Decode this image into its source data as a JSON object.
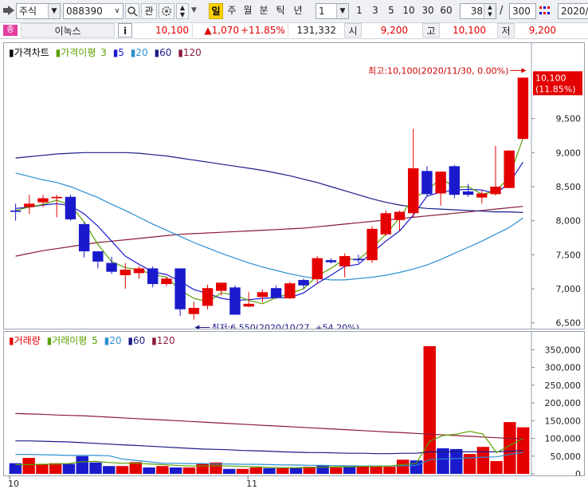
{
  "toolbar": {
    "market": "주식",
    "code": "088390",
    "btn_gwan": "관",
    "periods": [
      "일",
      "주",
      "월",
      "분",
      "틱",
      "년"
    ],
    "period_selected": "일",
    "interval_value": "1",
    "quick_intervals": [
      "1",
      "3",
      "5",
      "10",
      "30",
      "60"
    ],
    "count_value": "38",
    "separator": "/",
    "total_value": "300",
    "date_value": "2020/"
  },
  "quote": {
    "icon_label": "종",
    "name": "이녹스",
    "info_label": "i",
    "price": "10,100",
    "change": "▲1,070",
    "change_rate": "+11.85%",
    "volume": "131,332",
    "open_label": "시",
    "open": "9,200",
    "high_label": "고",
    "high": "10,100",
    "low_label": "저",
    "low": "9,200"
  },
  "price_legend": {
    "title": "가격차트",
    "ma_title": "가격이평",
    "ma_periods": [
      "3",
      "5",
      "20",
      "60",
      "120"
    ]
  },
  "volume_legend": {
    "title": "거래량",
    "ma_title": "거래이평",
    "ma_periods": [
      "5",
      "20",
      "60",
      "120"
    ]
  },
  "colors": {
    "up": "#e40000",
    "down": "#1a1acc",
    "ma3": "#5aa000",
    "ma5": "#1a1acc",
    "ma20": "#2a8fd0",
    "ma60": "#1c1c88",
    "ma120": "#8b1a3a",
    "annotation": "#cc0000"
  },
  "annotations": {
    "high_text": "최고:10,100(2020/11/30, 0.00%)",
    "low_text": "최저:6,550(2020/10/27, +54.20%)",
    "last_price": "10,100",
    "last_rate": "(11.85%)"
  },
  "chart_data": {
    "type": "candlestick",
    "x_labels": [
      "10",
      "11"
    ],
    "price_axis": {
      "ticks": [
        "9,500",
        "9,000",
        "8,500",
        "8,000",
        "7,500",
        "7,000",
        "6,500"
      ],
      "min": 6450,
      "max": 10350
    },
    "volume_axis": {
      "ticks": [
        "350,000",
        "300,000",
        "250,000",
        "200,000",
        "150,000",
        "100,000",
        "50,000",
        "0"
      ],
      "min": 0,
      "max": 360000
    },
    "candles": [
      {
        "o": 8150,
        "h": 8250,
        "l": 8000,
        "c": 8130
      },
      {
        "o": 8200,
        "h": 8380,
        "l": 8100,
        "c": 8250
      },
      {
        "o": 8270,
        "h": 8380,
        "l": 8200,
        "c": 8330
      },
      {
        "o": 8330,
        "h": 8380,
        "l": 8050,
        "c": 8350
      },
      {
        "o": 8350,
        "h": 8380,
        "l": 8000,
        "c": 8020
      },
      {
        "o": 7950,
        "h": 7980,
        "l": 7460,
        "c": 7550
      },
      {
        "o": 7550,
        "h": 7550,
        "l": 7300,
        "c": 7400
      },
      {
        "o": 7380,
        "h": 7470,
        "l": 7220,
        "c": 7250
      },
      {
        "o": 7200,
        "h": 7380,
        "l": 7000,
        "c": 7280
      },
      {
        "o": 7230,
        "h": 7330,
        "l": 7150,
        "c": 7300
      },
      {
        "o": 7300,
        "h": 7330,
        "l": 7020,
        "c": 7070
      },
      {
        "o": 7070,
        "h": 7180,
        "l": 7040,
        "c": 7150
      },
      {
        "o": 7300,
        "h": 7300,
        "l": 6600,
        "c": 6700
      },
      {
        "o": 6630,
        "h": 6810,
        "l": 6550,
        "c": 6720
      },
      {
        "o": 6750,
        "h": 7060,
        "l": 6700,
        "c": 7010
      },
      {
        "o": 6970,
        "h": 7080,
        "l": 6900,
        "c": 7090
      },
      {
        "o": 7020,
        "h": 7050,
        "l": 6620,
        "c": 6620
      },
      {
        "o": 6740,
        "h": 6950,
        "l": 6730,
        "c": 6780
      },
      {
        "o": 6880,
        "h": 6990,
        "l": 6800,
        "c": 6950
      },
      {
        "o": 7010,
        "h": 7050,
        "l": 6850,
        "c": 6870
      },
      {
        "o": 6860,
        "h": 7100,
        "l": 6850,
        "c": 7080
      },
      {
        "o": 7130,
        "h": 7150,
        "l": 7000,
        "c": 7050
      },
      {
        "o": 7140,
        "h": 7480,
        "l": 7080,
        "c": 7450
      },
      {
        "o": 7420,
        "h": 7450,
        "l": 7370,
        "c": 7390
      },
      {
        "o": 7330,
        "h": 7520,
        "l": 7170,
        "c": 7480
      },
      {
        "o": 7440,
        "h": 7500,
        "l": 7380,
        "c": 7420
      },
      {
        "o": 7420,
        "h": 7920,
        "l": 7380,
        "c": 7880
      },
      {
        "o": 7800,
        "h": 8150,
        "l": 7780,
        "c": 8110
      },
      {
        "o": 8010,
        "h": 8150,
        "l": 7850,
        "c": 8130
      },
      {
        "o": 8110,
        "h": 9350,
        "l": 8050,
        "c": 8770
      },
      {
        "o": 8730,
        "h": 8800,
        "l": 8350,
        "c": 8390
      },
      {
        "o": 8400,
        "h": 8720,
        "l": 8220,
        "c": 8720
      },
      {
        "o": 8800,
        "h": 8820,
        "l": 8330,
        "c": 8380
      },
      {
        "o": 8430,
        "h": 8540,
        "l": 8350,
        "c": 8380
      },
      {
        "o": 8340,
        "h": 8440,
        "l": 8250,
        "c": 8400
      },
      {
        "o": 8390,
        "h": 9100,
        "l": 8370,
        "c": 8500
      },
      {
        "o": 8480,
        "h": 9030,
        "l": 8480,
        "c": 9030
      },
      {
        "o": 9200,
        "h": 10100,
        "l": 9200,
        "c": 10100
      }
    ],
    "volumes": [
      30000,
      45000,
      28000,
      30000,
      28000,
      50000,
      32000,
      22000,
      22000,
      33000,
      18000,
      22000,
      18000,
      18000,
      28000,
      32000,
      14000,
      14000,
      18000,
      16000,
      16000,
      18000,
      20000,
      24000,
      18000,
      20000,
      22000,
      20000,
      20000,
      40000,
      38000,
      360000,
      72000,
      70000,
      56000,
      76000,
      36000,
      146000,
      131332
    ],
    "ma_price": {
      "ma3": [
        8150,
        8200,
        8240,
        8300,
        8230,
        7980,
        7650,
        7400,
        7310,
        7280,
        7210,
        7170,
        6980,
        6860,
        6810,
        6940,
        6910,
        6830,
        6780,
        6870,
        6930,
        7000,
        7190,
        7300,
        7440,
        7430,
        7600,
        7800,
        8040,
        8340,
        8430,
        8630,
        8490,
        8500,
        8390,
        8430,
        8640,
        9210
      ],
      "ma5": [
        8180,
        8200,
        8230,
        8250,
        8220,
        8100,
        7920,
        7700,
        7480,
        7360,
        7250,
        7210,
        7110,
        6990,
        6930,
        6860,
        6830,
        6840,
        6860,
        6870,
        6870,
        6940,
        7080,
        7200,
        7330,
        7360,
        7530,
        7700,
        7850,
        8080,
        8360,
        8420,
        8450,
        8460,
        8450,
        8400,
        8550,
        8860
      ],
      "ma20": [
        8700,
        8650,
        8600,
        8560,
        8500,
        8420,
        8340,
        8240,
        8150,
        8050,
        7950,
        7860,
        7770,
        7680,
        7600,
        7520,
        7450,
        7380,
        7320,
        7270,
        7220,
        7180,
        7150,
        7130,
        7130,
        7150,
        7170,
        7200,
        7240,
        7290,
        7350,
        7430,
        7520,
        7610,
        7700,
        7800,
        7900,
        8040
      ],
      "ma60": [
        8920,
        8940,
        8960,
        8980,
        8990,
        9000,
        9000,
        9000,
        9000,
        8990,
        8970,
        8950,
        8920,
        8890,
        8860,
        8830,
        8800,
        8770,
        8740,
        8700,
        8660,
        8610,
        8560,
        8500,
        8440,
        8380,
        8320,
        8270,
        8230,
        8200,
        8180,
        8170,
        8160,
        8150,
        8140,
        8130,
        8130,
        8120
      ],
      "ma120": [
        7480,
        7520,
        7560,
        7590,
        7620,
        7650,
        7680,
        7700,
        7720,
        7740,
        7760,
        7780,
        7800,
        7810,
        7820,
        7830,
        7840,
        7850,
        7860,
        7870,
        7880,
        7890,
        7910,
        7930,
        7950,
        7970,
        7990,
        8010,
        8030,
        8050,
        8070,
        8090,
        8110,
        8130,
        8150,
        8170,
        8190,
        8210
      ]
    },
    "ma_volume": {
      "ma5": [
        26000,
        26000,
        27000,
        28000,
        29000,
        34000,
        35000,
        32000,
        30000,
        30000,
        28000,
        26000,
        24000,
        22000,
        22000,
        23000,
        22000,
        21000,
        20000,
        18000,
        17000,
        17000,
        18000,
        19000,
        20000,
        20000,
        21000,
        21000,
        22000,
        26000,
        30000,
        92000,
        108000,
        112000,
        120000,
        112000,
        60000,
        80000,
        100000
      ],
      "ma20": [
        55000,
        55000,
        54000,
        53000,
        52000,
        52000,
        52000,
        51000,
        42000,
        38000,
        34000,
        30000,
        30000,
        29000,
        29000,
        28000,
        28000,
        27000,
        27000,
        26000,
        25000,
        25000,
        24000,
        24000,
        23000,
        23000,
        22000,
        22000,
        22000,
        23000,
        24000,
        40000,
        42000,
        43000,
        45000,
        47000,
        48000,
        55000,
        60000
      ],
      "ma60": [
        93000,
        93000,
        92000,
        91000,
        90000,
        88000,
        86000,
        84000,
        82000,
        80000,
        78000,
        76000,
        74000,
        72000,
        70000,
        69000,
        68000,
        66000,
        65000,
        64000,
        62000,
        61000,
        60000,
        60000,
        59000,
        58000,
        58000,
        57000,
        57000,
        58000,
        58000,
        62000,
        63000,
        62000,
        62000,
        62000,
        62000,
        64000,
        66000
      ],
      "ma120": [
        170000,
        169000,
        168000,
        166000,
        165000,
        164000,
        162000,
        160000,
        158000,
        156000,
        154000,
        152000,
        150000,
        148000,
        146000,
        144000,
        142000,
        140000,
        138000,
        136000,
        134000,
        132000,
        130000,
        128000,
        126000,
        124000,
        122000,
        120000,
        118000,
        116000,
        114000,
        112000,
        110000,
        108000,
        106000,
        104000,
        102000,
        100000,
        100000
      ]
    }
  }
}
